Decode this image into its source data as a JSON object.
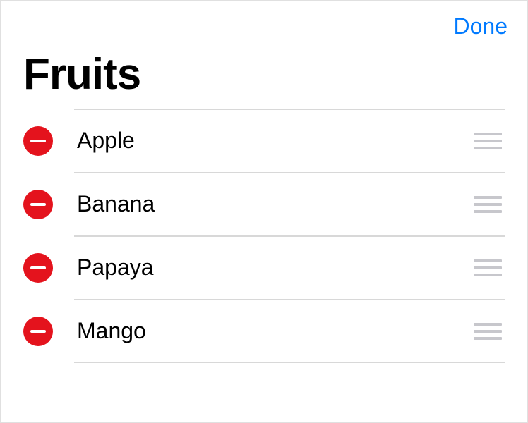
{
  "navbar": {
    "done_label": "Done"
  },
  "header": {
    "title": "Fruits"
  },
  "list": {
    "items": [
      {
        "label": "Apple"
      },
      {
        "label": "Banana"
      },
      {
        "label": "Papaya"
      },
      {
        "label": "Mango"
      }
    ]
  },
  "colors": {
    "accent": "#007aff",
    "delete": "#e4131d",
    "separator": "#d8d8d8",
    "reorder": "#c7c7cc"
  }
}
